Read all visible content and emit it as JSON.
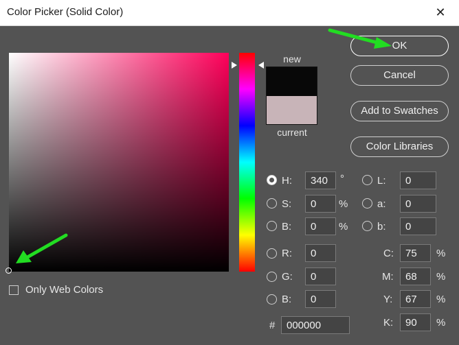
{
  "window": {
    "title": "Color Picker (Solid Color)",
    "close_glyph": "✕"
  },
  "preview": {
    "new_label": "new",
    "current_label": "current",
    "new_color": "#080808",
    "current_color": "#c8b4b8"
  },
  "buttons": {
    "ok": "OK",
    "cancel": "Cancel",
    "add_to_swatches": "Add to Swatches",
    "color_libraries": "Color Libraries"
  },
  "hsb": {
    "h": {
      "label": "H:",
      "value": "340",
      "unit": "°",
      "selected": true
    },
    "s": {
      "label": "S:",
      "value": "0",
      "unit": "%"
    },
    "b": {
      "label": "B:",
      "value": "0",
      "unit": "%"
    }
  },
  "lab": {
    "l": {
      "label": "L:",
      "value": "0"
    },
    "a": {
      "label": "a:",
      "value": "0"
    },
    "b": {
      "label": "b:",
      "value": "0"
    }
  },
  "rgb": {
    "r": {
      "label": "R:",
      "value": "0"
    },
    "g": {
      "label": "G:",
      "value": "0"
    },
    "b": {
      "label": "B:",
      "value": "0"
    }
  },
  "cmyk": {
    "c": {
      "label": "C:",
      "value": "75",
      "unit": "%"
    },
    "m": {
      "label": "M:",
      "value": "68",
      "unit": "%"
    },
    "y": {
      "label": "Y:",
      "value": "67",
      "unit": "%"
    },
    "k": {
      "label": "K:",
      "value": "90",
      "unit": "%"
    }
  },
  "hex": {
    "label": "#",
    "value": "000000"
  },
  "web_colors": {
    "label": "Only Web Colors",
    "checked": false
  },
  "colors": {
    "accent_arrow": "#22dd22",
    "hue_base": "#ff005a"
  }
}
